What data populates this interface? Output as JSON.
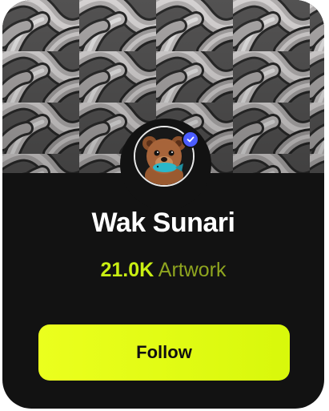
{
  "profile": {
    "name": "Wak Sunari",
    "avatar_icon": "bear-avatar",
    "verified_icon": "verified-check-icon"
  },
  "stats": {
    "artwork_count": "21.0K",
    "artwork_label": "Artwork"
  },
  "actions": {
    "follow_label": "Follow"
  },
  "colors": {
    "card_background": "#121212",
    "accent": "#d8f80b",
    "count_color": "#c9ef12",
    "label_color": "#8fa51f",
    "verified_badge": "#4b5cff"
  }
}
